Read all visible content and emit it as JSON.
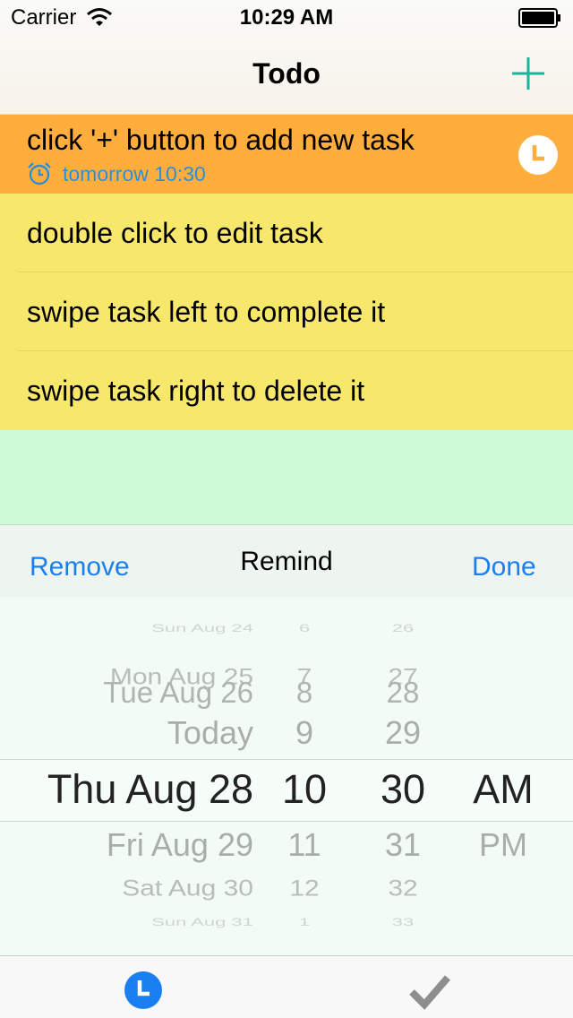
{
  "status_bar": {
    "carrier": "Carrier",
    "time": "10:29 AM"
  },
  "nav": {
    "title": "Todo",
    "add_icon": "plus-icon"
  },
  "tasks": [
    {
      "text": "click '+' button to add new task",
      "reminder": "tomorrow 10:30",
      "color": "#ffae3d",
      "has_alarm": true
    },
    {
      "text": "double click to edit task",
      "color": "#f7e76b"
    },
    {
      "text": "swipe task left to complete it",
      "color": "#f7e76b"
    },
    {
      "text": "swipe task right to delete it",
      "color": "#f7e76b"
    }
  ],
  "remind_toolbar": {
    "remove_label": "Remove",
    "title": "Remind",
    "done_label": "Done"
  },
  "picker": {
    "rows": [
      {
        "date": "Sun Aug 24",
        "hour": "6",
        "minute": "26",
        "ampm": ""
      },
      {
        "date": "Mon Aug 25",
        "hour": "7",
        "minute": "27",
        "ampm": ""
      },
      {
        "date": "Tue Aug 26",
        "hour": "8",
        "minute": "28",
        "ampm": ""
      },
      {
        "date": "Today",
        "hour": "9",
        "minute": "29",
        "ampm": ""
      },
      {
        "date": "Thu Aug 28",
        "hour": "10",
        "minute": "30",
        "ampm": "AM"
      },
      {
        "date": "Fri Aug 29",
        "hour": "11",
        "minute": "31",
        "ampm": "PM"
      },
      {
        "date": "Sat Aug 30",
        "hour": "12",
        "minute": "32",
        "ampm": ""
      },
      {
        "date": "Sun Aug 31",
        "hour": "1",
        "minute": "33",
        "ampm": ""
      }
    ],
    "selected": {
      "date": "Thu Aug 28",
      "hour": "10",
      "minute": "30",
      "ampm": "AM"
    }
  },
  "tab_bar": {
    "items": [
      {
        "name": "clock-icon",
        "active": true,
        "color": "#1a7ff0"
      },
      {
        "name": "checkmark-icon",
        "active": false,
        "color": "#8e8e8e"
      }
    ]
  },
  "colors": {
    "accent": "#1a7ff0",
    "add": "#19b59a",
    "green_area": "#ccfad6",
    "yellow": "#f7e76b",
    "orange": "#ffae3d"
  }
}
